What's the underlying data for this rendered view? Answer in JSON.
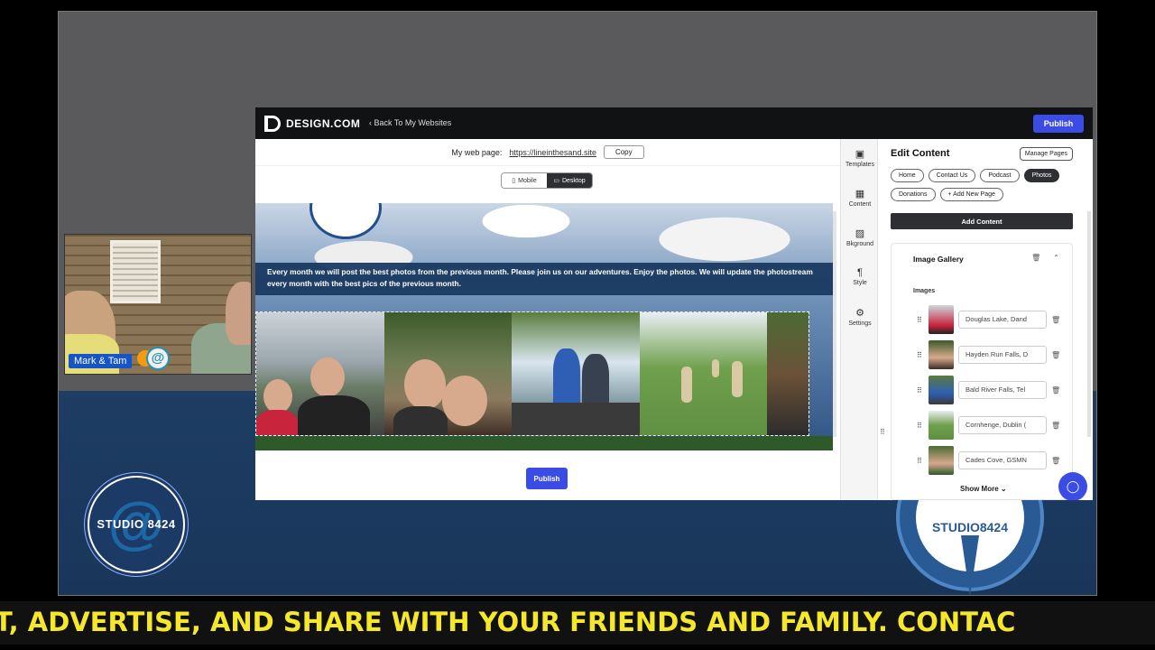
{
  "stream": {
    "presenter_names": "Mark & Tam",
    "studio_logo_text": "STUDIO 8424",
    "ticker_text": "T, ADVERTISE, AND SHARE WITH YOUR FRIENDS AND FAMILY. CONTAC"
  },
  "topbar": {
    "brand": "DESIGN.COM",
    "back_label": "Back To My Websites",
    "publish_label": "Publish"
  },
  "editor": {
    "url_label": "My web page:",
    "url_value": "https://lineinthesand.site",
    "copy_label": "Copy",
    "view_toggle": {
      "mobile": "Mobile",
      "desktop": "Desktop",
      "selected": "Desktop"
    },
    "banner_text": "Every month we will post the best photos from the previous month. Please join us on our adventures. Enjoy the photos. We will update the photostream every month with the best pics of the previous month.",
    "publish_label": "Publish"
  },
  "iconbar": [
    {
      "label": "Templates",
      "icon": "templates-icon"
    },
    {
      "label": "Content",
      "icon": "content-icon"
    },
    {
      "label": "Bkground",
      "icon": "background-icon"
    },
    {
      "label": "Style",
      "icon": "style-icon"
    },
    {
      "label": "Settings",
      "icon": "settings-icon"
    }
  ],
  "panel": {
    "title": "Edit Content",
    "manage_pages": "Manage Pages",
    "pages": [
      {
        "label": "Home",
        "active": false
      },
      {
        "label": "Contact Us",
        "active": false
      },
      {
        "label": "Podcast",
        "active": false
      },
      {
        "label": "Photos",
        "active": true
      },
      {
        "label": "Donations",
        "active": false
      },
      {
        "label": "+ Add New Page",
        "active": false
      }
    ],
    "add_content": "Add Content",
    "gallery": {
      "title": "Image Gallery",
      "images_label": "Images",
      "images": [
        "Douglas Lake, Dand",
        "Hayden Run Falls, D",
        "Bald River Falls, Tel",
        "Cornhenge, Dublin (",
        "Cades Cove, GSMN"
      ],
      "show_more": "Show More"
    }
  },
  "colors": {
    "accent": "#3b4ce6",
    "dark": "#2e2f33",
    "ticker": "#f5e82a",
    "banner": "#17375f"
  }
}
